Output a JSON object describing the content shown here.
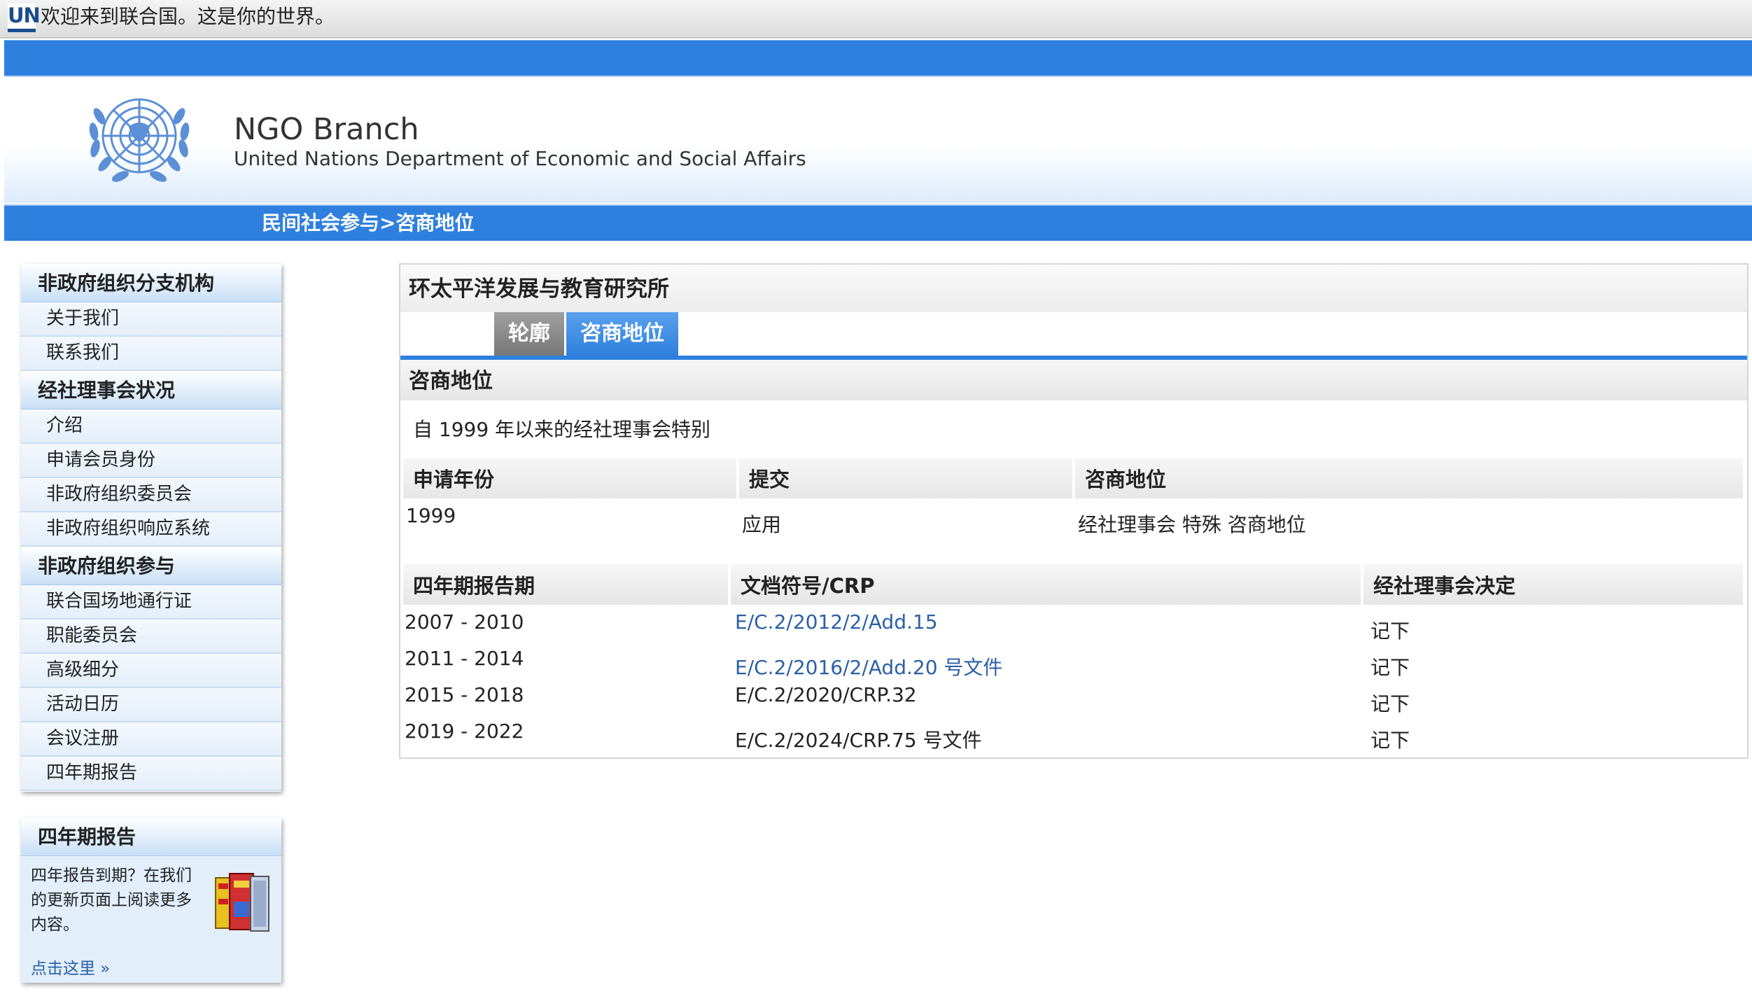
{
  "topbar": {
    "logo_text": "UN",
    "welcome": "欢迎来到联合国。这是你的世界。"
  },
  "header": {
    "org_name": "NGO Branch",
    "org_subtitle": "United Nations Department of Economic and Social Affairs",
    "breadcrumb": "民间社会参与>咨商地位"
  },
  "sidebar": {
    "sections": [
      {
        "title": "非政府组织分支机构",
        "items": [
          "关于我们",
          "联系我们"
        ]
      },
      {
        "title": "经社理事会状况",
        "items": [
          "介绍",
          "申请会员身份",
          "非政府组织委员会",
          "非政府组织响应系统"
        ]
      },
      {
        "title": "非政府组织参与",
        "items": [
          "联合国场地通行证",
          "职能委员会",
          "高级细分",
          "活动日历",
          "会议注册",
          "四年期报告"
        ]
      }
    ],
    "promo": {
      "title": "四年期报告",
      "text": "四年报告到期？在我们的更新页面上阅读更多内容。",
      "link": "点击这里 »"
    }
  },
  "main": {
    "org_title": "环太平洋发展与教育研究所",
    "tabs": [
      {
        "label": "轮廓",
        "active": false
      },
      {
        "label": "咨商地位",
        "active": true
      }
    ],
    "section_title": "咨商地位",
    "description": "自 1999 年以来的经社理事会特别",
    "status_table": {
      "headers": [
        "申请年份",
        "提交",
        "咨商地位"
      ],
      "row": [
        "1999",
        "应用",
        "经社理事会 特殊 咨商地位"
      ]
    },
    "reports_table": {
      "headers": [
        "四年期报告期",
        "文档符号/CRP",
        "经社理事会决定"
      ],
      "rows": [
        {
          "period": "2007 - 2010",
          "doc": "E/C.2/2012/2/Add.15",
          "doc_is_link": true,
          "decision": "记下"
        },
        {
          "period": "2011 - 2014",
          "doc": "E/C.2/2016/2/Add.20 号文件",
          "doc_is_link": true,
          "decision": "记下"
        },
        {
          "period": "2015 - 2018",
          "doc": "E/C.2/2020/CRP.32",
          "doc_is_link": false,
          "decision": "记下"
        },
        {
          "period": "2019 - 2022",
          "doc": "E/C.2/2024/CRP.75 号文件",
          "doc_is_link": false,
          "decision": "记下"
        }
      ]
    }
  },
  "colors": {
    "primary_blue": "#2f80de",
    "link": "#2a5fa8",
    "tab_inactive": "#8a8a8a"
  }
}
